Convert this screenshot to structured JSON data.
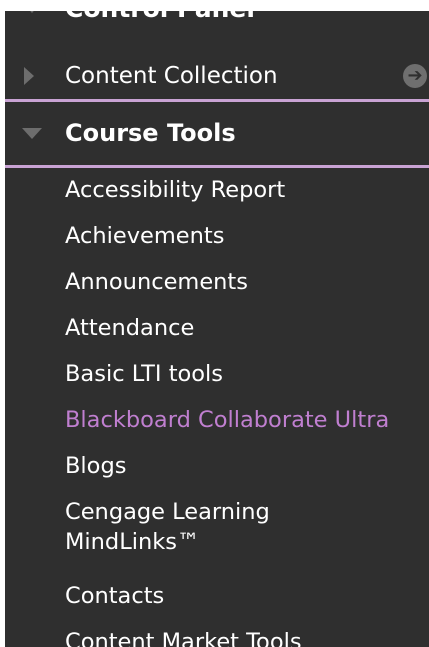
{
  "control_panel": {
    "label": "Control Panel"
  },
  "content_collection": {
    "label": "Content Collection",
    "icon": "arrow-right-circle-icon"
  },
  "course_tools": {
    "label": "Course Tools",
    "items": [
      {
        "label": "Accessibility Report"
      },
      {
        "label": "Achievements"
      },
      {
        "label": "Announcements"
      },
      {
        "label": "Attendance"
      },
      {
        "label": "Basic LTI tools"
      },
      {
        "label": "Blackboard Collaborate Ultra"
      },
      {
        "label": "Blogs"
      },
      {
        "label_line1": "Cengage Learning",
        "label_line2": "MindLinks™"
      },
      {
        "label": "Contacts"
      },
      {
        "label": "Content Market Tools"
      }
    ]
  },
  "colors": {
    "panel_bg": "#2f2f2f",
    "text": "#ffffff",
    "active_link": "#c07fd0",
    "divider": "#c9a3d4",
    "icon_gray": "#6d6d6d"
  }
}
